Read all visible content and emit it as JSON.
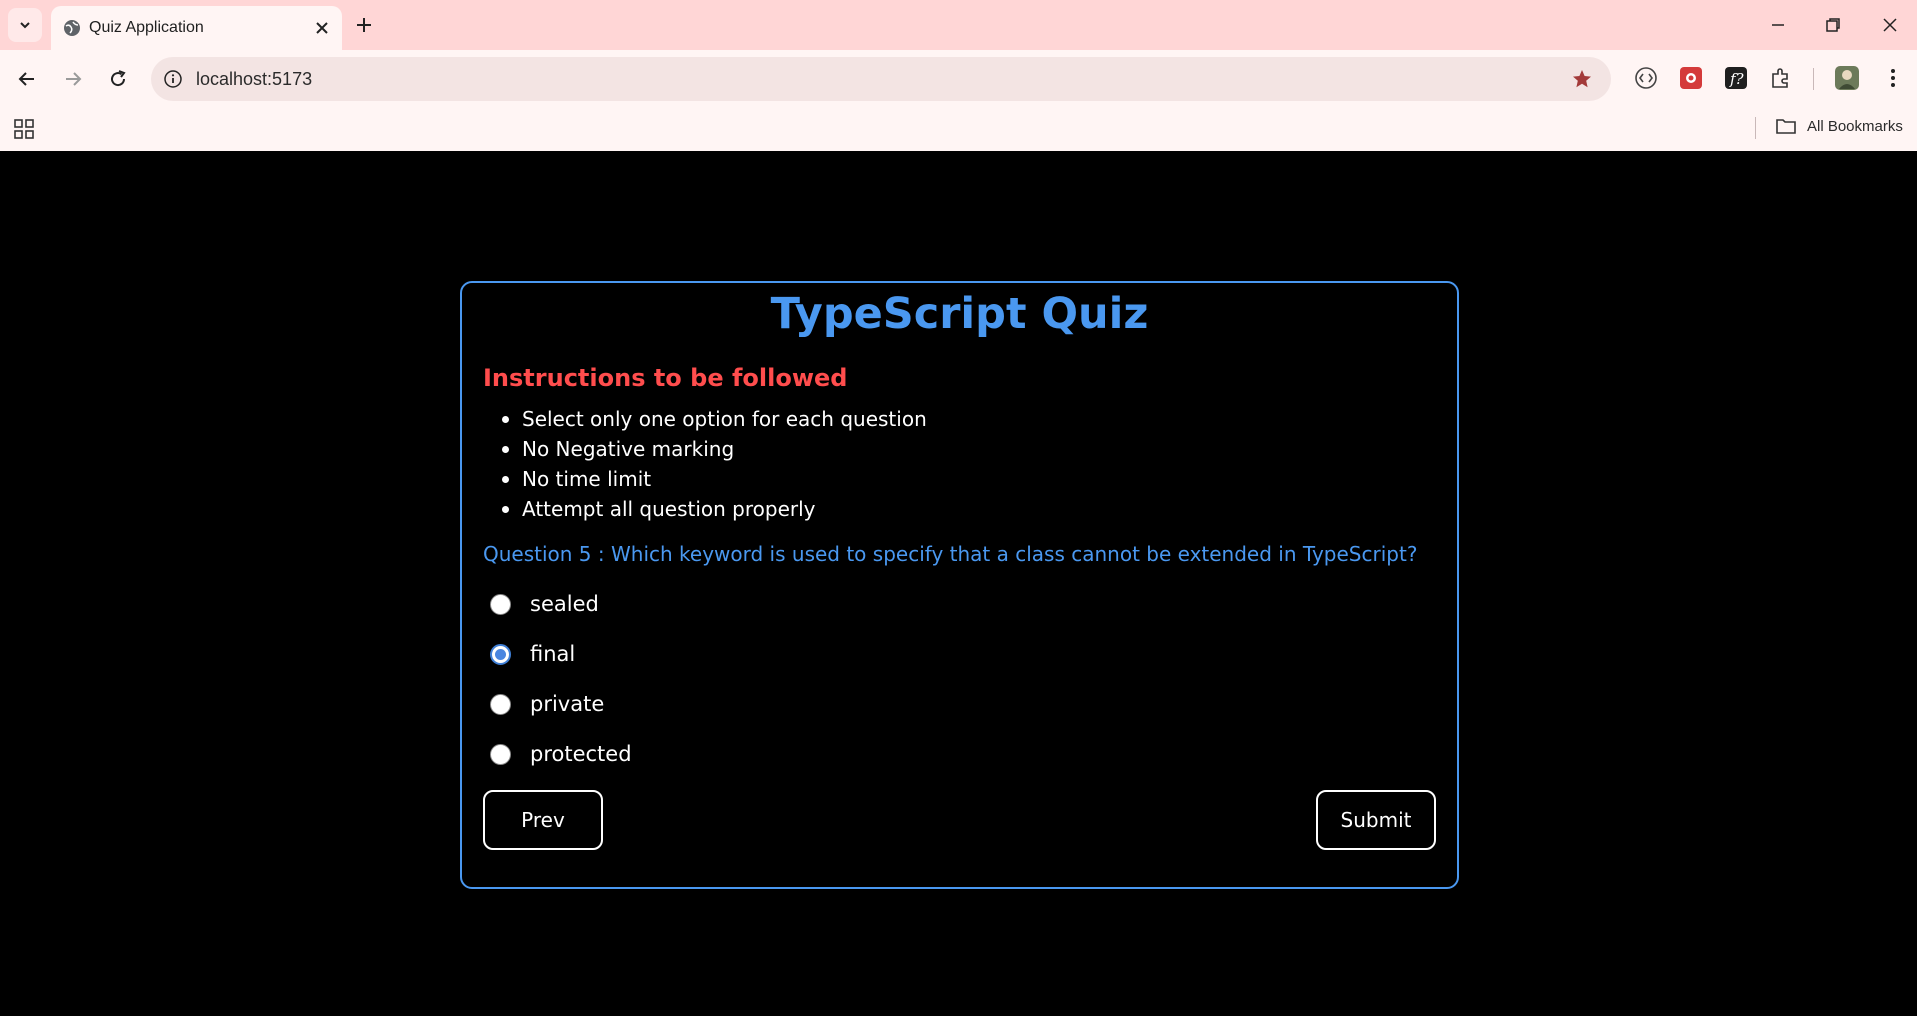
{
  "browser": {
    "tab": {
      "title": "Quiz Application"
    },
    "omnibox": {
      "url": "localhost:5173"
    },
    "bookmarks": {
      "all_label": "All Bookmarks"
    }
  },
  "quiz": {
    "title": "TypeScript Quiz",
    "instructions_heading": "Instructions to be followed",
    "instructions": [
      "Select only one option for each question",
      "No Negative marking",
      "No time limit",
      "Attempt all question properly"
    ],
    "question": "Question 5 : Which keyword is used to specify that a class cannot be extended in TypeScript?",
    "options": [
      {
        "label": "sealed",
        "selected": false
      },
      {
        "label": "final",
        "selected": true
      },
      {
        "label": "private",
        "selected": false
      },
      {
        "label": "protected",
        "selected": false
      }
    ],
    "prev_label": "Prev",
    "submit_label": "Submit"
  },
  "colors": {
    "accent_blue": "#4a98f0",
    "instructions_red": "#ff4d4d",
    "chrome_tabstrip": "#ffd6d6"
  }
}
